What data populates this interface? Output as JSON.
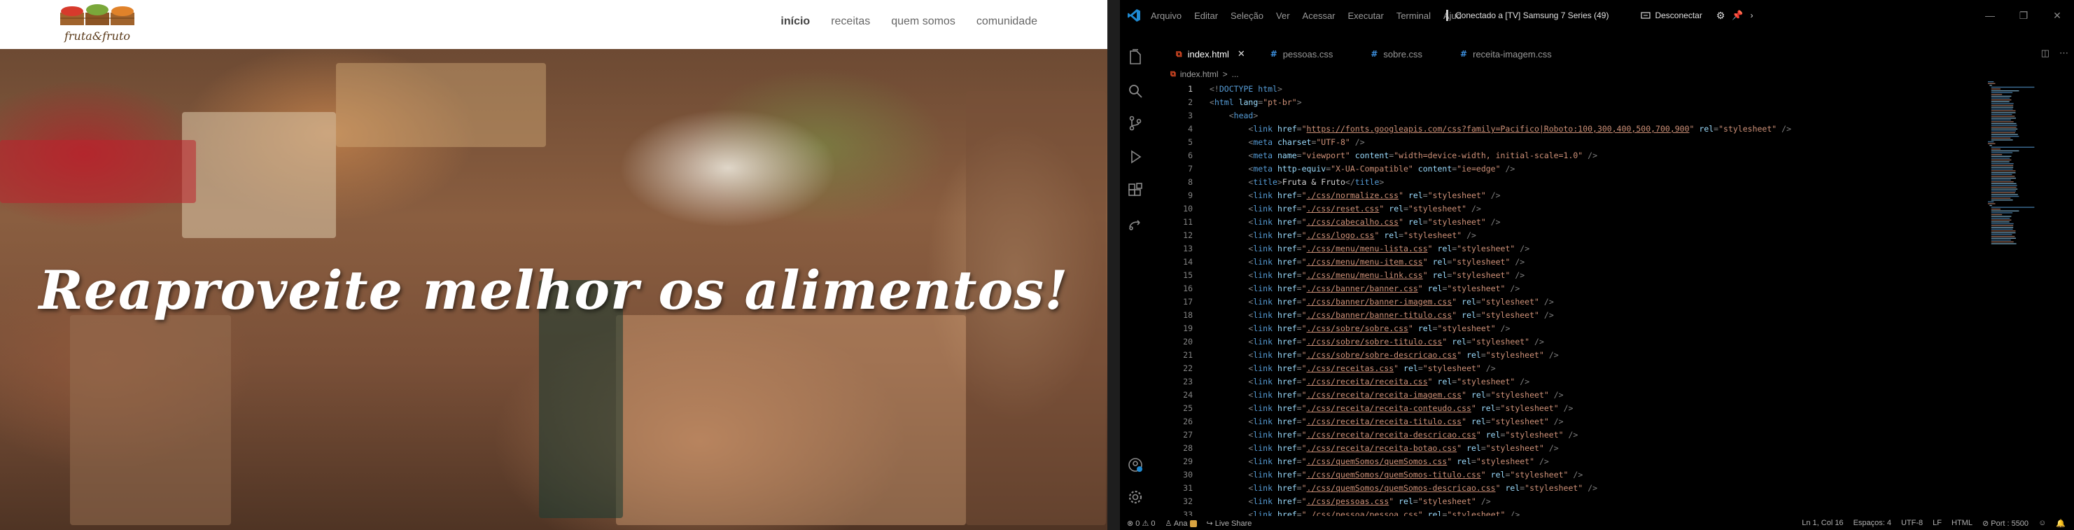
{
  "site": {
    "logo_text": "fruta&fruto",
    "nav": [
      {
        "label": "início",
        "active": true
      },
      {
        "label": "receitas",
        "active": false
      },
      {
        "label": "quem somos",
        "active": false
      },
      {
        "label": "comunidade",
        "active": false
      }
    ],
    "banner_title": "Reaproveite melhor os alimentos!"
  },
  "vscode": {
    "menu": [
      "Arquivo",
      "Editar",
      "Seleção",
      "Ver",
      "Acessar",
      "Executar",
      "Terminal",
      "Ajud"
    ],
    "remote": {
      "connection": "Conectado a [TV] Samsung 7 Series (49)",
      "disconnect": "Desconectar"
    },
    "tabs": [
      {
        "label": "index.html",
        "type": "html",
        "active": true
      },
      {
        "label": "pessoas.css",
        "type": "css",
        "active": false
      },
      {
        "label": "sobre.css",
        "type": "css",
        "active": false
      },
      {
        "label": "receita-imagem.css",
        "type": "css",
        "active": false
      }
    ],
    "breadcrumb": [
      "index.html",
      ">",
      "..."
    ],
    "status": {
      "errors": "0",
      "warnings": "0",
      "user": "Ana",
      "liveshare": "Live Share",
      "position": "Ln 1, Col 16",
      "spaces": "Espaços: 4",
      "encoding": "UTF-8",
      "eol": "LF",
      "language": "HTML",
      "port": "Port : 5500"
    },
    "colors": {
      "html_icon": "#e44d26",
      "css_icon": "#3c8edc",
      "accent": "#007acc"
    }
  },
  "code_lines": [
    "<!DOCTYPE html>",
    "<html lang=\"pt-br\">",
    "    <head>",
    "        <link href=\"https://fonts.googleapis.com/css?family=Pacifico|Roboto:100,300,400,500,700,900\" rel=\"stylesheet\" />",
    "        <meta charset=\"UTF-8\" />",
    "        <meta name=\"viewport\" content=\"width=device-width, initial-scale=1.0\" />",
    "        <meta http-equiv=\"X-UA-Compatible\" content=\"ie=edge\" />",
    "        <title>Fruta & Fruto</title>",
    "        <link href=\"./css/normalize.css\" rel=\"stylesheet\" />",
    "        <link href=\"./css/reset.css\" rel=\"stylesheet\" />",
    "        <link href=\"./css/cabecalho.css\" rel=\"stylesheet\" />",
    "        <link href=\"./css/logo.css\" rel=\"stylesheet\" />",
    "        <link href=\"./css/menu/menu-lista.css\" rel=\"stylesheet\" />",
    "        <link href=\"./css/menu/menu-item.css\" rel=\"stylesheet\" />",
    "        <link href=\"./css/menu/menu-link.css\" rel=\"stylesheet\" />",
    "        <link href=\"./css/banner/banner.css\" rel=\"stylesheet\" />",
    "        <link href=\"./css/banner/banner-imagem.css\" rel=\"stylesheet\" />",
    "        <link href=\"./css/banner/banner-titulo.css\" rel=\"stylesheet\" />",
    "        <link href=\"./css/sobre/sobre.css\" rel=\"stylesheet\" />",
    "        <link href=\"./css/sobre/sobre-titulo.css\" rel=\"stylesheet\" />",
    "        <link href=\"./css/sobre/sobre-descricao.css\" rel=\"stylesheet\" />",
    "        <link href=\"./css/receitas.css\" rel=\"stylesheet\" />",
    "        <link href=\"./css/receita/receita.css\" rel=\"stylesheet\" />",
    "        <link href=\"./css/receita/receita-imagem.css\" rel=\"stylesheet\" />",
    "        <link href=\"./css/receita/receita-conteudo.css\" rel=\"stylesheet\" />",
    "        <link href=\"./css/receita/receita-titulo.css\" rel=\"stylesheet\" />",
    "        <link href=\"./css/receita/receita-descricao.css\" rel=\"stylesheet\" />",
    "        <link href=\"./css/receita/receita-botao.css\" rel=\"stylesheet\" />",
    "        <link href=\"./css/quemSomos/quemSomos.css\" rel=\"stylesheet\" />",
    "        <link href=\"./css/quemSomos/quemSomos-titulo.css\" rel=\"stylesheet\" />",
    "        <link href=\"./css/quemSomos/quemSomos-descricao.css\" rel=\"stylesheet\" />",
    "        <link href=\"./css/pessoas.css\" rel=\"stylesheet\" />",
    "        <link href=\"./css/pessoa/pessoa.css\" rel=\"stylesheet\" />"
  ]
}
